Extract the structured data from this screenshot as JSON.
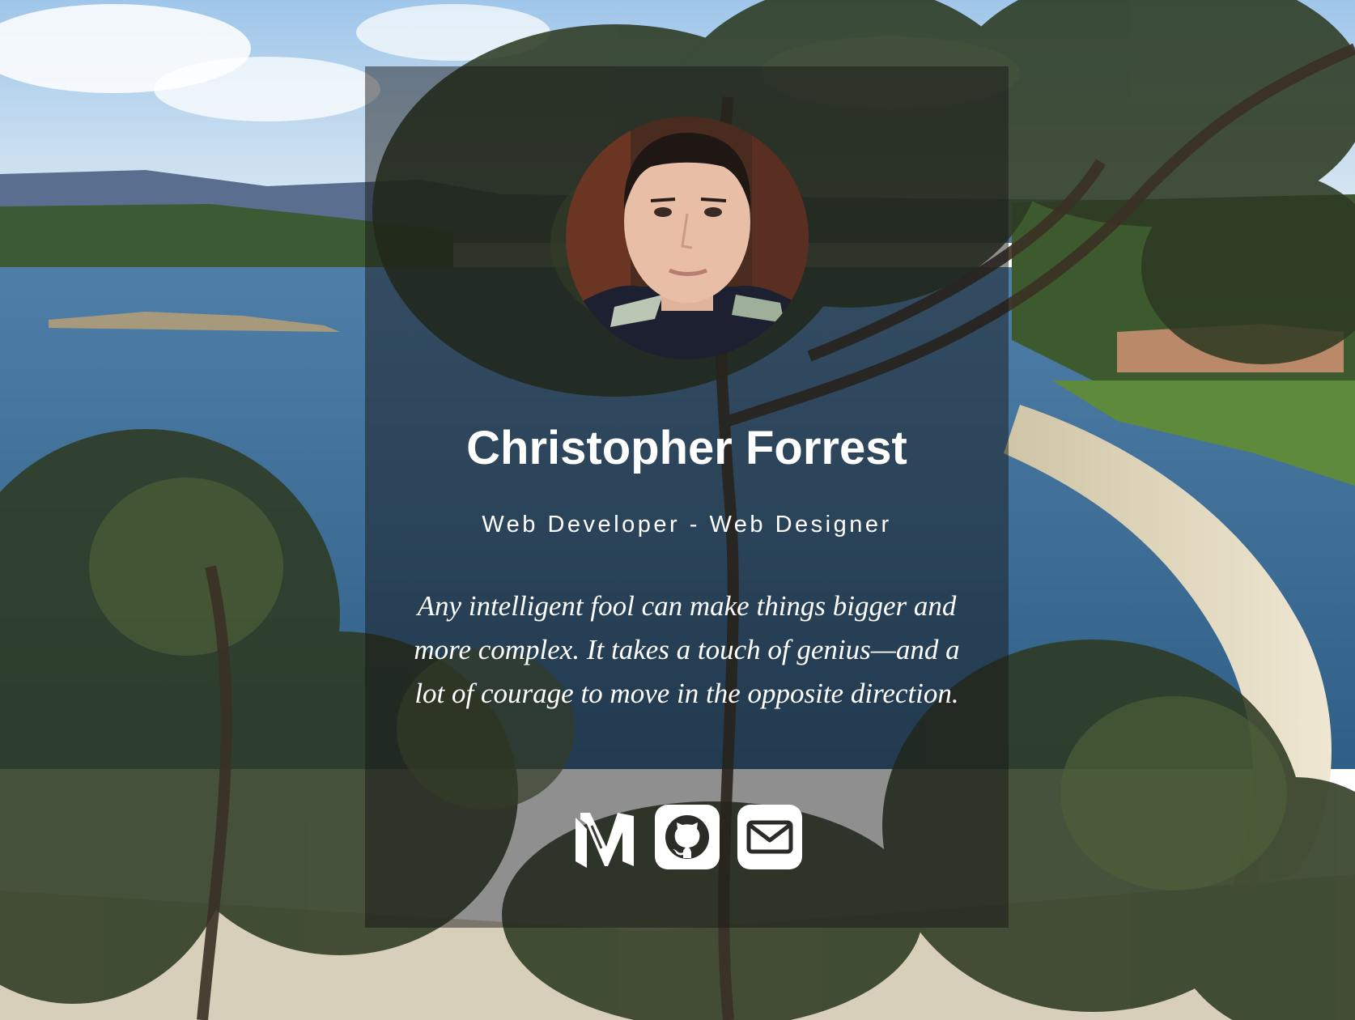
{
  "profile": {
    "name": "Christopher Forrest",
    "role": "Web Developer - Web Designer",
    "quote": "Any intelligent fool can make things bigger and more complex. It takes a touch of genius—and a lot of courage to move in the opposite direction."
  },
  "social": [
    {
      "icon": "medium-icon"
    },
    {
      "icon": "github-icon"
    },
    {
      "icon": "mail-icon"
    }
  ],
  "colors": {
    "text": "#ffffff",
    "card_overlay": "rgba(20,20,20,0.48)"
  }
}
